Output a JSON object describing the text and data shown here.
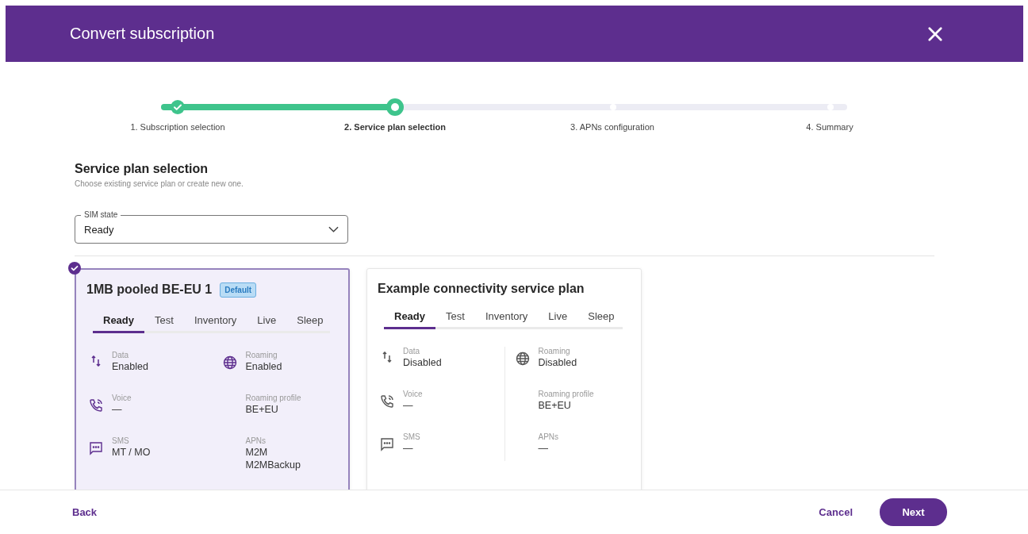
{
  "dialog": {
    "title": "Convert subscription"
  },
  "steps": [
    {
      "label": "1. Subscription selection",
      "completed": true,
      "selected": false
    },
    {
      "label": "2. Service plan selection",
      "completed": false,
      "selected": true
    },
    {
      "label": "3. APNs configuration",
      "completed": false,
      "selected": false
    },
    {
      "label": "4. Summary",
      "completed": false,
      "selected": false
    }
  ],
  "section": {
    "title": "Service plan selection",
    "subtitle": "Choose existing service plan or create new one."
  },
  "sim_state": {
    "label": "SIM state",
    "value": "Ready"
  },
  "plans": [
    {
      "name": "1MB pooled BE-EU 1",
      "badge": "Default",
      "selected": true,
      "tabs": [
        {
          "label": "Ready",
          "selected": true
        },
        {
          "label": "Test",
          "selected": false
        },
        {
          "label": "Inventory",
          "selected": false
        },
        {
          "label": "Live",
          "selected": false
        },
        {
          "label": "Sleep",
          "selected": false
        }
      ],
      "left": [
        {
          "kind": "data",
          "label": "Data",
          "values": [
            "Enabled"
          ]
        },
        {
          "kind": "voice",
          "label": "Voice",
          "values": [
            "—"
          ]
        },
        {
          "kind": "sms",
          "label": "SMS",
          "values": [
            "MT / MO"
          ]
        }
      ],
      "right": [
        {
          "kind": "roaming",
          "label": "Roaming",
          "values": [
            "Enabled"
          ]
        },
        {
          "kind": "plain",
          "label": "Roaming profile",
          "values": [
            "BE+EU"
          ]
        },
        {
          "kind": "plain",
          "label": "APNs",
          "values": [
            "M2M",
            "M2MBackup"
          ]
        }
      ]
    },
    {
      "name": "Example connectivity service plan",
      "selected": false,
      "tabs": [
        {
          "label": "Ready",
          "selected": true
        },
        {
          "label": "Test",
          "selected": false
        },
        {
          "label": "Inventory",
          "selected": false
        },
        {
          "label": "Live",
          "selected": false
        },
        {
          "label": "Sleep",
          "selected": false
        }
      ],
      "left": [
        {
          "kind": "data",
          "label": "Data",
          "values": [
            "Disabled"
          ]
        },
        {
          "kind": "voice",
          "label": "Voice",
          "values": [
            "—"
          ]
        },
        {
          "kind": "sms",
          "label": "SMS",
          "values": [
            "—"
          ]
        }
      ],
      "right": [
        {
          "kind": "roaming",
          "label": "Roaming",
          "values": [
            "Disabled"
          ]
        },
        {
          "kind": "plain",
          "label": "Roaming profile",
          "values": [
            "BE+EU"
          ]
        },
        {
          "kind": "plain",
          "label": "APNs",
          "values": [
            "—"
          ]
        }
      ]
    }
  ],
  "footer": {
    "back": "Back",
    "cancel": "Cancel",
    "next": "Next"
  }
}
